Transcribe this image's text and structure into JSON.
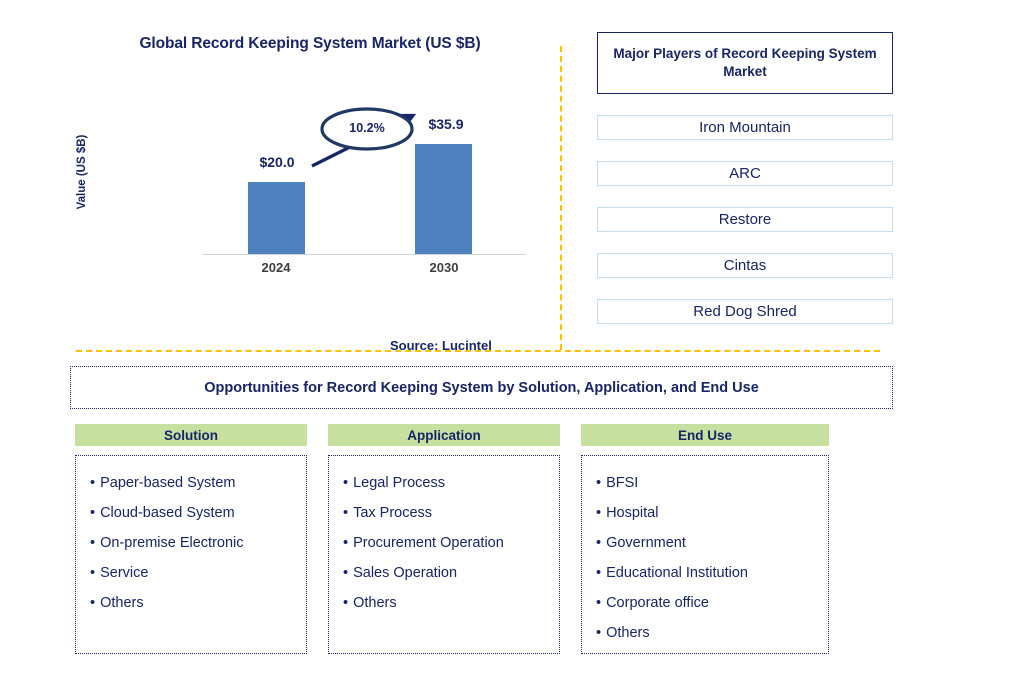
{
  "chart": {
    "title": "Global Record Keeping System Market (US $B)",
    "y_axis_title": "Value (US $B)",
    "source": "Source: Lucintel",
    "cagr_label": "10.2%",
    "value_2024": "$20.0",
    "value_2030": "$35.9",
    "label_2024": "2024",
    "label_2030": "2030"
  },
  "chart_data": {
    "type": "bar",
    "title": "Global Record Keeping System Market (US $B)",
    "xlabel": "",
    "ylabel": "Value (US $B)",
    "categories": [
      "2024",
      "2030"
    ],
    "values": [
      20.0,
      35.9
    ],
    "data_labels": [
      "$20.0",
      "$35.9"
    ],
    "ylim": [
      0,
      40
    ],
    "grid": false,
    "legend": "none",
    "annotations": [
      {
        "text": "10.2%",
        "type": "cagr-ellipse-with-arrow",
        "from": "2024",
        "to": "2030"
      }
    ],
    "source": "Source: Lucintel",
    "bar_color": "#4E81BD"
  },
  "players": {
    "header": "Major Players of Record Keeping System Market",
    "items": [
      {
        "name": "Iron Mountain"
      },
      {
        "name": "ARC"
      },
      {
        "name": "Restore"
      },
      {
        "name": "Cintas"
      },
      {
        "name": "Red Dog Shred"
      }
    ]
  },
  "opportunities": {
    "banner": "Opportunities for Record Keeping System by Solution, Application, and End Use",
    "bullet": "•",
    "columns": [
      {
        "header": "Solution",
        "items": [
          "Paper-based System",
          "Cloud-based System",
          "On-premise Electronic",
          "Service",
          "Others"
        ]
      },
      {
        "header": "Application",
        "items": [
          "Legal Process",
          "Tax Process",
          "Procurement Operation",
          "Sales Operation",
          "Others"
        ]
      },
      {
        "header": "End Use",
        "items": [
          "BFSI",
          "Hospital",
          "Government",
          "Educational Institution",
          "Corporate office",
          "Others"
        ]
      }
    ]
  },
  "colors": {
    "navy": "#17256B",
    "bar_blue": "#4E81BD",
    "gold_divider": "#FFC000",
    "header_green": "#C7E0A0",
    "player_border": "#C5DCEC"
  }
}
